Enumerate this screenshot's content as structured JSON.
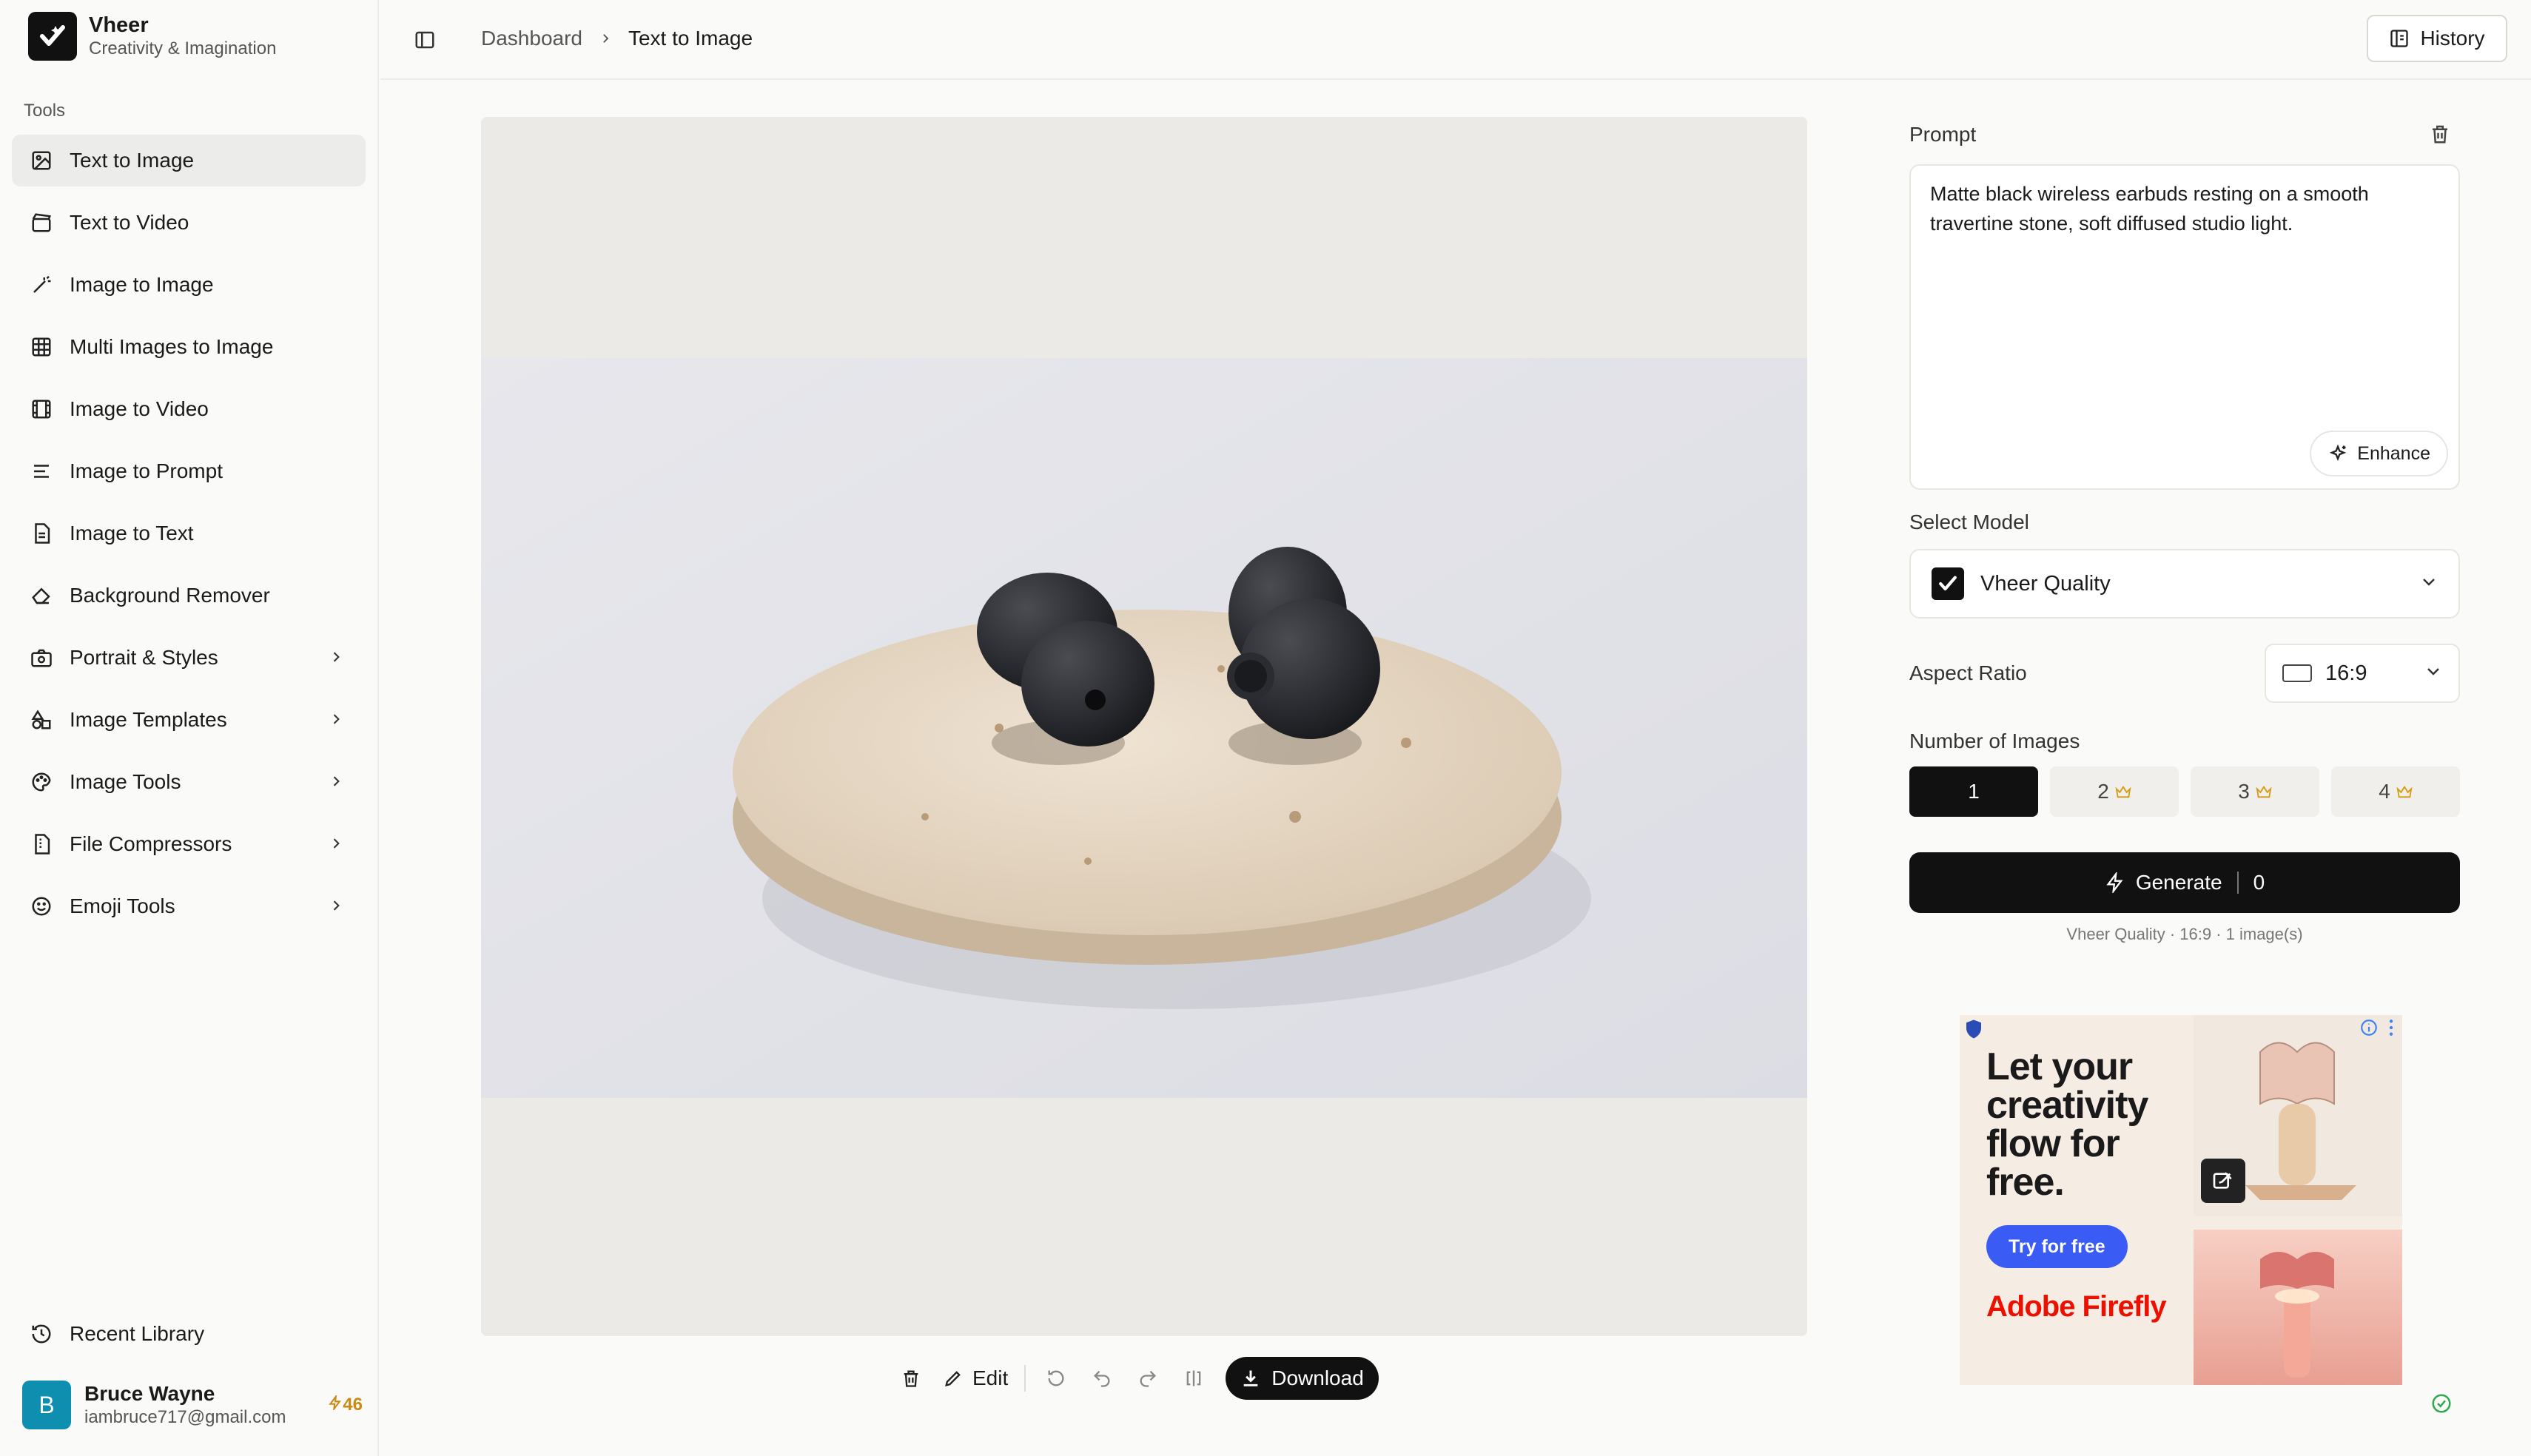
{
  "app": {
    "name": "Vheer",
    "tagline": "Creativity & Imagination"
  },
  "sidebar": {
    "section_label": "Tools",
    "items": [
      {
        "label": "Text to Image",
        "icon": "image-edit-icon",
        "active": true
      },
      {
        "label": "Text to Video",
        "icon": "clapperboard-icon"
      },
      {
        "label": "Image to Image",
        "icon": "magic-wand-icon"
      },
      {
        "label": "Multi Images to Image",
        "icon": "grid-icon"
      },
      {
        "label": "Image to Video",
        "icon": "film-icon"
      },
      {
        "label": "Image to Prompt",
        "icon": "text-lines-icon"
      },
      {
        "label": "Image to Text",
        "icon": "document-icon"
      },
      {
        "label": "Background Remover",
        "icon": "eraser-icon"
      },
      {
        "label": "Portrait & Styles",
        "icon": "camera-icon",
        "expandable": true
      },
      {
        "label": "Image Templates",
        "icon": "shapes-icon",
        "expandable": true
      },
      {
        "label": "Image Tools",
        "icon": "palette-icon",
        "expandable": true
      },
      {
        "label": "File Compressors",
        "icon": "file-zip-icon",
        "expandable": true
      },
      {
        "label": "Emoji Tools",
        "icon": "smile-icon",
        "expandable": true
      }
    ],
    "recent_label": "Recent Library"
  },
  "user": {
    "initial": "B",
    "name": "Bruce Wayne",
    "email": "iambruce717@gmail.com",
    "credits": "46"
  },
  "header": {
    "breadcrumb": [
      "Dashboard",
      "Text to Image"
    ],
    "history_label": "History"
  },
  "toolbar": {
    "edit_label": "Edit",
    "download_label": "Download"
  },
  "panel": {
    "prompt_label": "Prompt",
    "prompt_text": "Matte black wireless earbuds resting on a smooth travertine stone, soft diffused studio light.",
    "enhance_label": "Enhance",
    "model_label": "Select Model",
    "model_value": "Vheer Quality",
    "aspect_label": "Aspect Ratio",
    "aspect_value": "16:9",
    "count_label": "Number of Images",
    "counts": [
      "1",
      "2",
      "3",
      "4"
    ],
    "generate_label": "Generate",
    "generate_cost": "0",
    "summary": "Vheer Quality · 16:9 · 1 image(s)"
  },
  "ad": {
    "headline_1": "Let your",
    "headline_2": "creativity",
    "headline_3": "flow for",
    "headline_4": "free.",
    "cta": "Try for free",
    "brand": "Adobe Firefly"
  },
  "colors": {
    "accent": "#111111",
    "credits": "#c98a16",
    "avatar": "#0f8fb0",
    "ad_cta": "#3b5bf5",
    "adobe_red": "#eb1000"
  }
}
